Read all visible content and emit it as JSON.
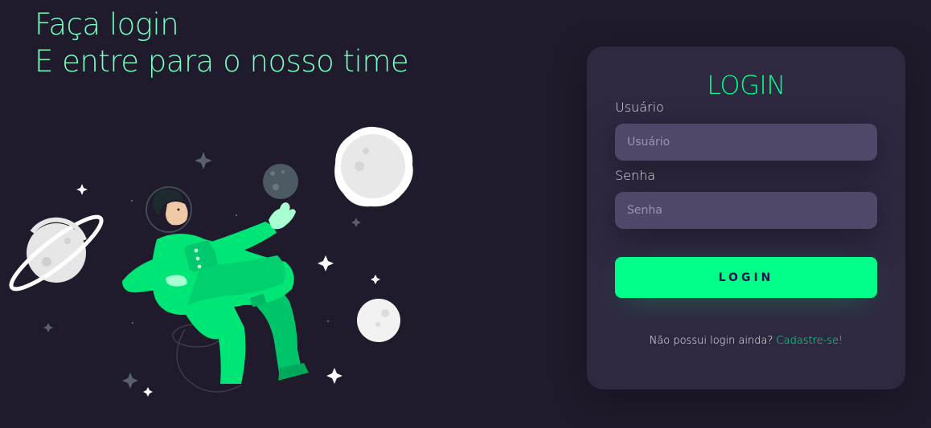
{
  "hero": {
    "line1": "Faça login",
    "line2": "E entre para o nosso time"
  },
  "login_card": {
    "title": "LOGIN",
    "username": {
      "label": "Usuário",
      "placeholder": "Usuário",
      "value": ""
    },
    "password": {
      "label": "Senha",
      "placeholder": "Senha",
      "value": ""
    },
    "submit_label": "Login",
    "signup_prompt": "Não possui login ainda?",
    "signup_link": "Cadastre-se!"
  },
  "colors": {
    "background": "#201b2c",
    "card": "#2f2841",
    "input": "#514869",
    "accent": "#00ff88",
    "headline": "#77ffc0"
  },
  "illustration": {
    "subject": "astronaut-floating-in-space",
    "elements": [
      "astronaut",
      "ringed-planet",
      "moon-large",
      "moon-small",
      "asteroid",
      "stars"
    ]
  }
}
